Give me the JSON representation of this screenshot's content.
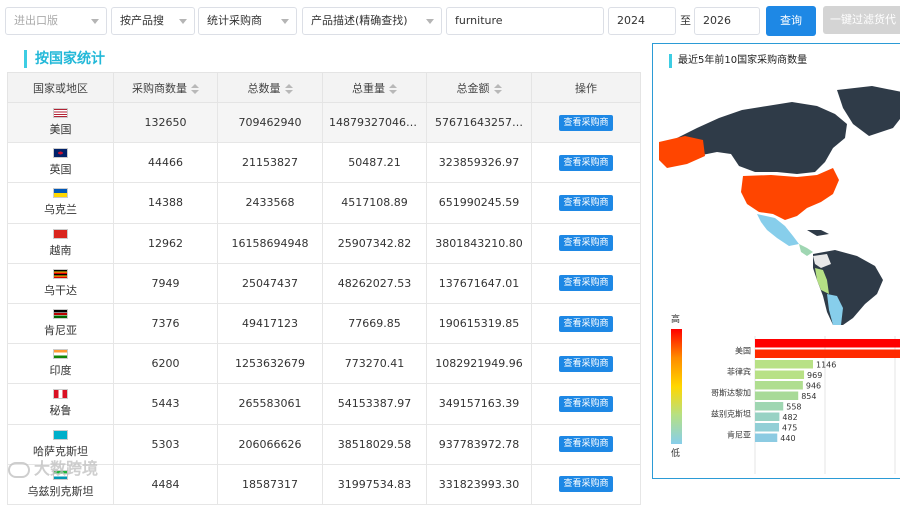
{
  "filters": {
    "trade_type": "进出口版",
    "search_by": "按产品搜",
    "stat_by": "统计采购商",
    "desc_mode": "产品描述(精确查找)",
    "keyword": "furniture",
    "year_from": "2024",
    "to_label": "至",
    "year_to": "2026",
    "query_button": "查询",
    "filter_button": "一键过滤货代"
  },
  "section_title": "按国家统计",
  "table": {
    "headers": [
      "国家或地区",
      "采购商数量",
      "总数量",
      "总重量",
      "总金额",
      "操作"
    ],
    "action_label": "查看采购商",
    "rows": [
      {
        "flag": "us-flag-icon",
        "country": "美国",
        "buyers": "132650",
        "qty": "709462940",
        "weight": "14879327046.…",
        "amount": "57671643257…"
      },
      {
        "flag": "uk-flag-icon",
        "country": "英国",
        "buyers": "44466",
        "qty": "21153827",
        "weight": "50487.21",
        "amount": "323859326.97"
      },
      {
        "flag": "ukraine-flag-icon",
        "country": "乌克兰",
        "buyers": "14388",
        "qty": "2433568",
        "weight": "4517108.89",
        "amount": "651990245.59"
      },
      {
        "flag": "vietnam-flag-icon",
        "country": "越南",
        "buyers": "12962",
        "qty": "16158694948",
        "weight": "25907342.82",
        "amount": "3801843210.80"
      },
      {
        "flag": "uganda-flag-icon",
        "country": "乌干达",
        "buyers": "7949",
        "qty": "25047437",
        "weight": "48262027.53",
        "amount": "137671647.01"
      },
      {
        "flag": "kenya-flag-icon",
        "country": "肯尼亚",
        "buyers": "7376",
        "qty": "49417123",
        "weight": "77669.85",
        "amount": "190615319.85"
      },
      {
        "flag": "india-flag-icon",
        "country": "印度",
        "buyers": "6200",
        "qty": "1253632679",
        "weight": "773270.41",
        "amount": "1082921949.96"
      },
      {
        "flag": "peru-flag-icon",
        "country": "秘鲁",
        "buyers": "5443",
        "qty": "265583061",
        "weight": "54153387.97",
        "amount": "349157163.39"
      },
      {
        "flag": "kazakhstan-flag-icon",
        "country": "哈萨克斯坦",
        "buyers": "5303",
        "qty": "206066626",
        "weight": "38518029.58",
        "amount": "937783972.78"
      },
      {
        "flag": "uzbekistan-flag-icon",
        "country": "乌兹别克斯坦",
        "buyers": "4484",
        "qty": "18587317",
        "weight": "31997534.83",
        "amount": "331823993.30"
      }
    ]
  },
  "panel": {
    "title": "最近5年前10国家采购商数量",
    "legend_high": "高",
    "legend_low": "低"
  },
  "chart_data": {
    "type": "bar",
    "orientation": "horizontal",
    "categories": [
      "美国",
      "",
      "菲律宾",
      "",
      "哥斯达黎加",
      "",
      "兹别克斯坦",
      "",
      "肯尼亚"
    ],
    "values": [
      null,
      null,
      1146,
      969,
      946,
      854,
      558,
      482,
      475,
      440
    ],
    "bar_labels": [
      "",
      "",
      "1146",
      "969",
      "946",
      "854",
      "558",
      "482",
      "475",
      "440"
    ],
    "colors": [
      "#ff0000",
      "#ff2a00",
      "#b8e186",
      "#b8e186",
      "#b0de90",
      "#a8da98",
      "#9fd6b2",
      "#98d2c4",
      "#92cfd6",
      "#8ccbe2"
    ]
  },
  "colors": {
    "accent": "#1e88e5",
    "title_cyan": "#22b8d8",
    "map_dark": "#2f3b48",
    "map_usa": "#ff4500",
    "map_light_blue": "#87ceeb",
    "map_green": "#b5e085"
  },
  "watermark": "大数跨境"
}
